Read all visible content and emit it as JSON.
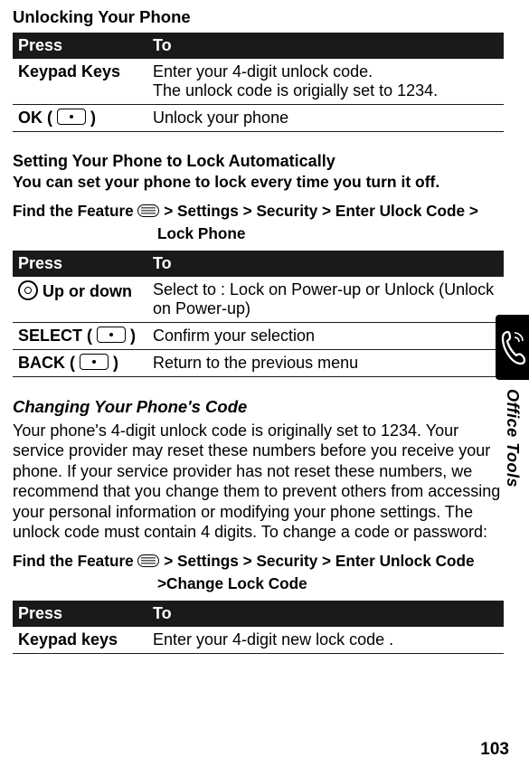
{
  "page_number": "103",
  "section_tab": "Office Tools",
  "s1": {
    "title": "Unlocking Your Phone",
    "head_press": "Press",
    "head_to": "To",
    "r1_press": "Keypad Keys",
    "r1_to": "Enter your 4-digit unlock code.\nThe unlock code is origially set to 1234.",
    "r2_press_pre": "OK ( ",
    "r2_press_post": " )",
    "r2_to": "Unlock your phone"
  },
  "s2": {
    "title": "Setting Your Phone to Lock Automatically",
    "intro": "You can set your phone to lock every time you turn it off.",
    "feature_label": "Find the Feature ",
    "feature_path1": " > Settings > Security > Enter Ulock Code >",
    "feature_path2": "Lock Phone",
    "head_press": "Press",
    "head_to": "To",
    "r1_press": " Up or down",
    "r1_to": "Select to : Lock on Power-up or Unlock (Unlock on Power-up)",
    "r2_press_pre": "SELECT ( ",
    "r2_press_post": " )",
    "r2_to": "Confirm your selection",
    "r3_press_pre": "BACK ( ",
    "r3_press_post": " )",
    "r3_to": "Return to the previous menu"
  },
  "s3": {
    "title": "Changing Your Phone's Code",
    "body": "Your phone's 4-digit unlock code is originally set to 1234. Your service provider may reset these numbers before you receive your phone. If your service provider has not reset these numbers, we recommend that you change them to prevent others from accessing your personal information or modifying your phone settings. The unlock code must contain 4 digits. To change a code or password:",
    "feature_label": "Find the Feature ",
    "feature_path1": " > Settings > Security > Enter Unlock Code",
    "feature_path2": ">Change Lock Code",
    "head_press": "Press",
    "head_to": "To",
    "r1_press": "Keypad keys",
    "r1_to": "Enter your 4-digit new lock code ."
  }
}
